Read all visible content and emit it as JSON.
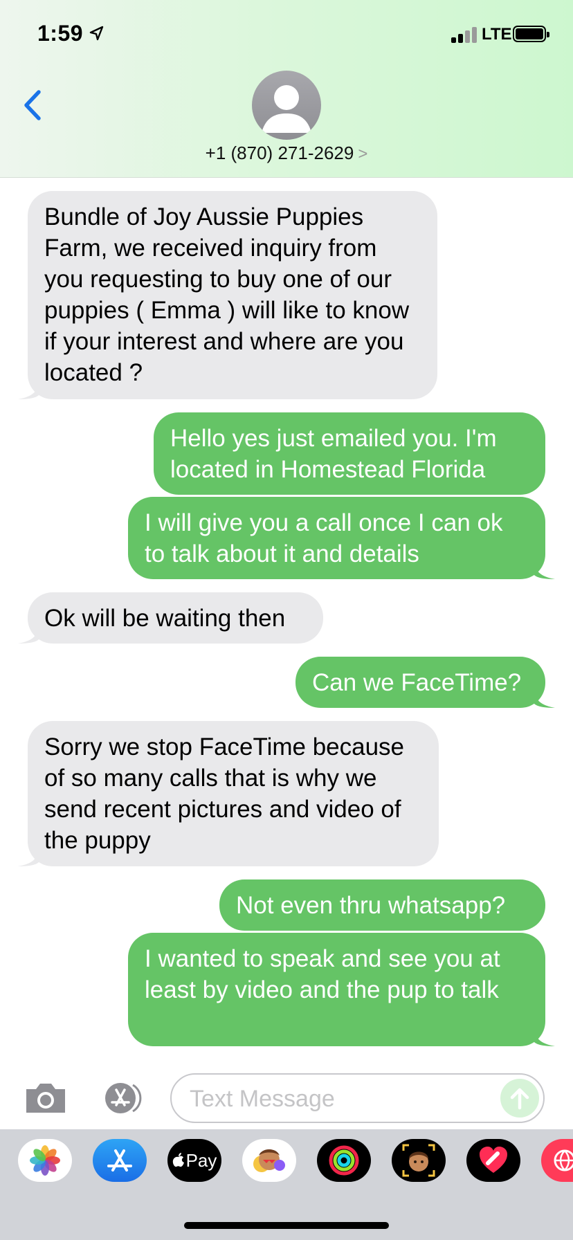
{
  "status_bar": {
    "time": "1:59",
    "network": "LTE"
  },
  "header": {
    "contact": "+1 (870) 271-2629",
    "contact_chevron": ">"
  },
  "messages": [
    {
      "from": "them",
      "text": "Bundle of Joy Aussie Puppies Farm, we received inquiry from you requesting  to buy one of our puppies ( Emma ) will like to know if your interest and where are you located ?"
    },
    {
      "from": "me",
      "text": "Hello yes just emailed you. I'm located in Homestead Florida"
    },
    {
      "from": "me",
      "text": "I will give you a call once I can ok to talk about it and details"
    },
    {
      "from": "them",
      "text": "Ok will be waiting then"
    },
    {
      "from": "me",
      "text": "Can we FaceTime?"
    },
    {
      "from": "them",
      "text": "Sorry we stop FaceTime because of so many calls that is why we send recent pictures and video of the puppy"
    },
    {
      "from": "me",
      "text": "Not even thru whatsapp?"
    },
    {
      "from": "me",
      "text": "I wanted to speak and see you at least by video and the pup to talk"
    }
  ],
  "input": {
    "placeholder": "Text Message"
  },
  "app_drawer": {
    "apple_pay_label": "Pay",
    "apps": [
      "photos-icon",
      "app-store-icon",
      "apple-pay-icon",
      "animoji-stickers-icon",
      "activity-icon",
      "memoji-icon",
      "digital-touch-icon",
      "search-web-icon"
    ]
  },
  "colors": {
    "sent_bubble": "#65c466",
    "received_bubble": "#e9e9eb",
    "accent": "#1a73e8"
  }
}
